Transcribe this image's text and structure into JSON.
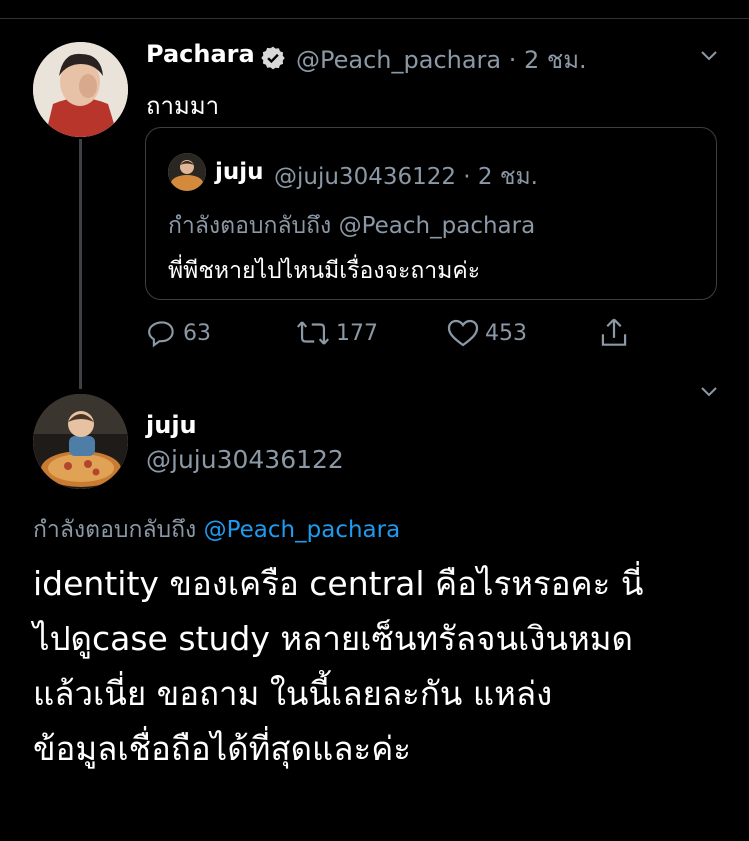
{
  "tweet1": {
    "author_name": "Pachara",
    "handle_time": "@Peach_pachara · 2 ชม.",
    "text": "ถามมา",
    "verified_icon": "verified-badge-icon",
    "quote": {
      "author_name": "juju",
      "handle_time": "@juju30436122 · 2 ชม.",
      "reply_prefix": "กำลังตอบกลับถึง",
      "reply_to": "@Peach_pachara",
      "text": "พี่พีชหายไปไหนมีเรื่องจะถามค่ะ"
    },
    "actions": {
      "reply_count": "63",
      "retweet_count": "177",
      "like_count": "453"
    }
  },
  "tweet2": {
    "author_name": "juju",
    "handle": "@juju30436122",
    "reply_prefix": "กำลังตอบกลับถึง",
    "reply_to": "@Peach_pachara",
    "lines": [
      "identity ของเครือ central คือไรหรอคะ นี่",
      "ไปดูcase study หลายเซ็นทรัลจนเงินหมด",
      "แล้วเนี่ย ขอถาม ในนี้เลยละกัน แหล่ง",
      "ข้อมูลเชื่อถือได้ที่สุดและค่ะ"
    ]
  },
  "colors": {
    "background": "#000000",
    "secondary": "#8b98a5",
    "link": "#1d9bf0",
    "border": "#3a3f44"
  }
}
